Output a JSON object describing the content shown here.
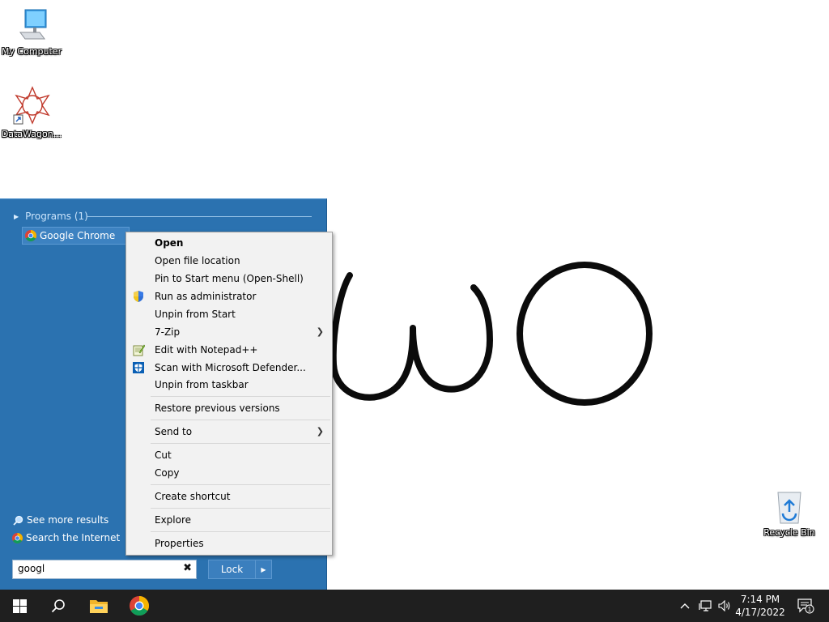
{
  "desktop": {
    "icons": [
      {
        "label": "My Computer"
      },
      {
        "label": "DataWagon..."
      },
      {
        "label": "Recycle Bin"
      }
    ]
  },
  "start_menu": {
    "programs_header": "Programs (1)",
    "program_item": "Google Chrome",
    "see_more": "See more results",
    "search_internet": "Search the Internet",
    "search_value": "googl",
    "lock_label": "Lock"
  },
  "context_menu": {
    "items": [
      {
        "label": "Open",
        "bold": true
      },
      {
        "label": "Open file location"
      },
      {
        "label": "Pin to Start menu (Open-Shell)"
      },
      {
        "label": "Run as administrator",
        "icon": "uac-shield-icon"
      },
      {
        "label": "Unpin from Start"
      },
      {
        "label": "7-Zip",
        "submenu": true
      },
      {
        "label": "Edit with Notepad++",
        "icon": "notepadpp-icon"
      },
      {
        "label": "Scan with Microsoft Defender...",
        "icon": "defender-icon"
      },
      {
        "label": "Unpin from taskbar"
      },
      {
        "label": "Restore previous versions"
      },
      {
        "label": "Send to",
        "submenu": true
      },
      {
        "label": "Cut"
      },
      {
        "label": "Copy"
      },
      {
        "label": "Create shortcut"
      },
      {
        "label": "Explore"
      },
      {
        "label": "Properties"
      }
    ]
  },
  "taskbar": {
    "clock_time": "7:14 PM",
    "clock_date": "4/17/2022",
    "notification_count": "1"
  }
}
